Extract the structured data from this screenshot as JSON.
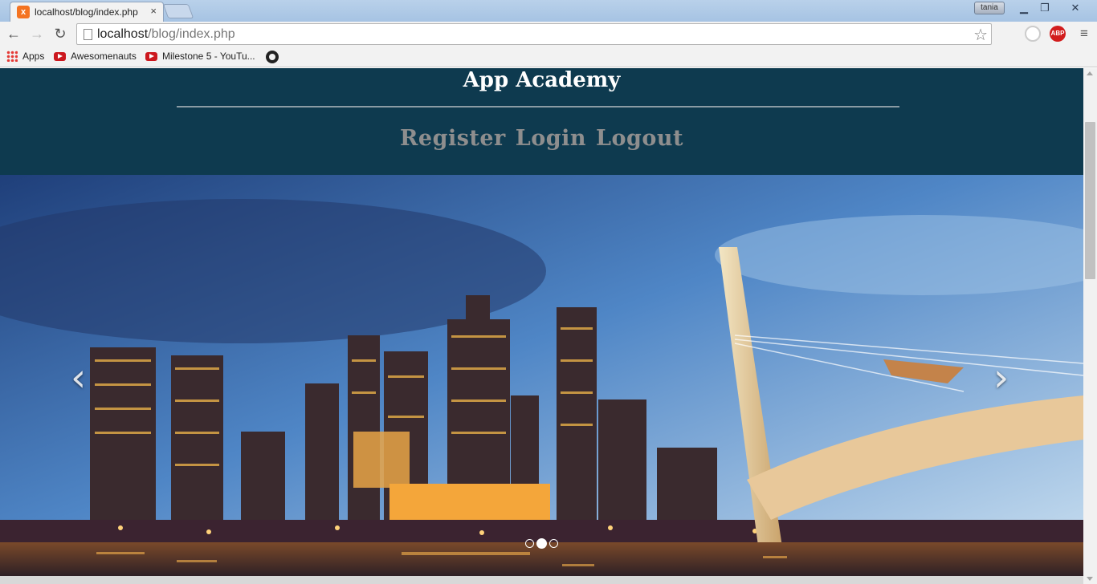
{
  "browser": {
    "tab_title": "localhost/blog/index.php",
    "tab_close": "×",
    "user_badge": "tania",
    "url_host": "localhost",
    "url_path": "/blog/index.php",
    "ext_abp_label": "ABP",
    "bookmarks": [
      {
        "label": "Apps",
        "icon": "apps-grid-icon"
      },
      {
        "label": "Awesomenauts",
        "icon": "youtube-icon"
      },
      {
        "label": "Milestone 5 - YouTu...",
        "icon": "youtube-icon"
      },
      {
        "label": "",
        "icon": "github-icon"
      }
    ]
  },
  "site": {
    "title": "App Academy",
    "nav": {
      "register": "Register",
      "login": "Login",
      "logout": "Logout"
    }
  },
  "carousel": {
    "prev_label": "‹",
    "next_label": "›",
    "slide_count": 3,
    "active_index": 1
  }
}
